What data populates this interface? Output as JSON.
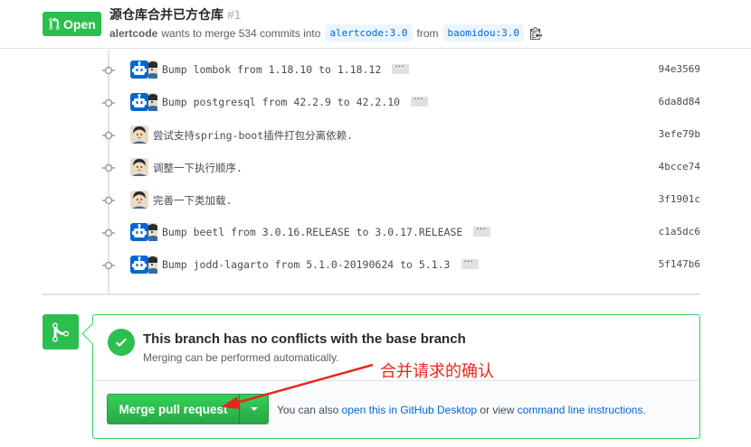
{
  "header": {
    "state_label": "Open",
    "title": "源仓库合并已方仓库",
    "number": "#1",
    "author": "alertcode",
    "wants_to_merge_text": "wants to merge 534 commits into",
    "base_branch": "alertcode:3.0",
    "from_text": "from",
    "head_branch": "baomidou:3.0",
    "copy_icon": "clippy-icon"
  },
  "commits": [
    {
      "message": "Bump lombok from 1.18.10 to 1.18.12",
      "sha": "94e3569",
      "author_type": "bot"
    },
    {
      "message": "Bump postgresql from 42.2.9 to 42.2.10",
      "sha": "6da8d84",
      "author_type": "bot"
    },
    {
      "message": "尝试支持spring-boot插件打包分离依赖.",
      "sha": "3efe79b",
      "author_type": "human"
    },
    {
      "message": "调整一下执行顺序.",
      "sha": "4bcce74",
      "author_type": "human"
    },
    {
      "message": "完善一下类加载.",
      "sha": "3f1901c",
      "author_type": "human"
    },
    {
      "message": "Bump beetl from 3.0.16.RELEASE to 3.0.17.RELEASE",
      "sha": "c1a5dc6",
      "author_type": "bot"
    },
    {
      "message": "Bump jodd-lagarto from 5.1.0-20190624 to 5.1.3",
      "sha": "5f147b6",
      "author_type": "bot"
    }
  ],
  "merge": {
    "status_title": "This branch has no conflicts with the base branch",
    "status_sub": "Merging can be performed automatically.",
    "merge_button": "Merge pull request",
    "also_prefix": "You can also",
    "open_desktop_link": "open this in GitHub Desktop",
    "or_view": "or view",
    "cli_link": "command line instructions",
    "suffix": "."
  },
  "annotation": {
    "text": "合并请求的确认",
    "color": "#e8261b"
  },
  "colors": {
    "green": "#2cbe4e",
    "link": "#0366d6",
    "branch_bg": "#eaf5ff"
  }
}
